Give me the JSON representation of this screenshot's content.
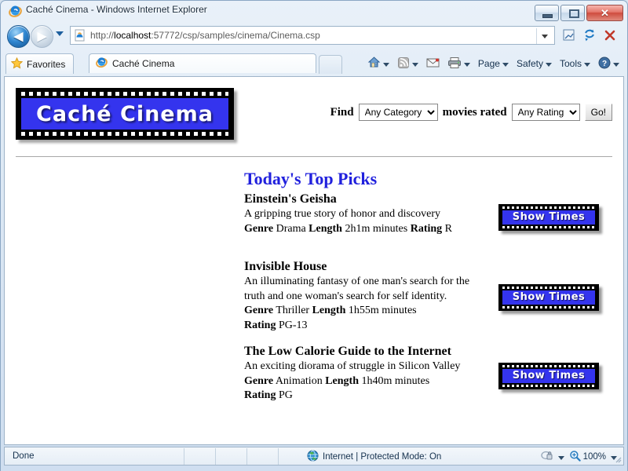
{
  "window": {
    "title": "Caché Cinema - Windows Internet Explorer",
    "app_icon": "ie-logo-icon",
    "minimize_label": "Minimize",
    "maximize_label": "Maximize",
    "close_label": "Close",
    "close_glyph": "✕"
  },
  "navigation": {
    "back_label": "Back",
    "back_glyph": "◀",
    "forward_label": "Forward",
    "forward_glyph": "▶",
    "recent_pages_label": "Recent Pages",
    "address": {
      "scheme": "http://",
      "host": "localhost",
      "port": ":57772",
      "path": "/csp/samples/cinema/Cinema.csp",
      "full": "http://localhost:57772/csp/samples/cinema/Cinema.csp"
    },
    "compat_view_label": "Compatibility View",
    "refresh_label": "Refresh",
    "stop_label": "Stop"
  },
  "tabs": {
    "favorites_label": "Favorites",
    "items": [
      {
        "label": "Caché Cinema",
        "icon": "ie-logo-icon",
        "active": true
      }
    ],
    "new_tab_label": "New Tab"
  },
  "command_bar": {
    "items": [
      {
        "name": "home",
        "label": "",
        "icon": "home-icon",
        "has_caret": true
      },
      {
        "name": "feeds",
        "label": "",
        "icon": "rss-icon",
        "has_caret": true
      },
      {
        "name": "read-mail",
        "label": "",
        "icon": "mail-icon",
        "has_caret": false
      },
      {
        "name": "print",
        "label": "",
        "icon": "printer-icon",
        "has_caret": true
      },
      {
        "name": "page",
        "label": "Page",
        "icon": "",
        "has_caret": true
      },
      {
        "name": "safety",
        "label": "Safety",
        "icon": "",
        "has_caret": true
      },
      {
        "name": "tools",
        "label": "Tools",
        "icon": "",
        "has_caret": true
      },
      {
        "name": "help",
        "label": "",
        "icon": "help-icon",
        "has_caret": true
      }
    ]
  },
  "page": {
    "logo_text": "Caché Cinema",
    "find_bar": {
      "find_label": "Find",
      "category_value": "Any Category",
      "category_options": [
        "Any Category"
      ],
      "middle_label": "movies rated",
      "rating_value": "Any Rating",
      "rating_options": [
        "Any Rating"
      ],
      "go_label": "Go!"
    },
    "picks_heading": "Today's Top Picks",
    "labels": {
      "genre": "Genre",
      "length": "Length",
      "rating": "Rating",
      "minutes_suffix": "minutes",
      "show_times": "Show Times"
    },
    "movies": [
      {
        "title": "Einstein's Geisha",
        "description": "A gripping true story of honor and discovery",
        "genre": "Drama",
        "length": "2h1m",
        "rating": "R"
      },
      {
        "title": "Invisible House",
        "description": "An illuminating fantasy of one man's search for the truth and one woman's search for self identity.",
        "genre": "Thriller",
        "length": "1h55m",
        "rating": "PG-13"
      },
      {
        "title": "The Low Calorie Guide to the Internet",
        "description": "An exciting diorama of struggle in Silicon Valley",
        "genre": "Animation",
        "length": "1h40m",
        "rating": "PG"
      }
    ]
  },
  "status_bar": {
    "text": "Done",
    "zone": "Internet | Protected Mode: On",
    "zone_icon": "globe-icon",
    "privacy_icon": "privacy-icon",
    "zoom_level": "100%",
    "zoom_icon": "magnifier-icon"
  },
  "colors": {
    "brand_blue": "#3434ee",
    "heading_blue": "#2020dd",
    "frame_blue": "#d6e3f0"
  }
}
